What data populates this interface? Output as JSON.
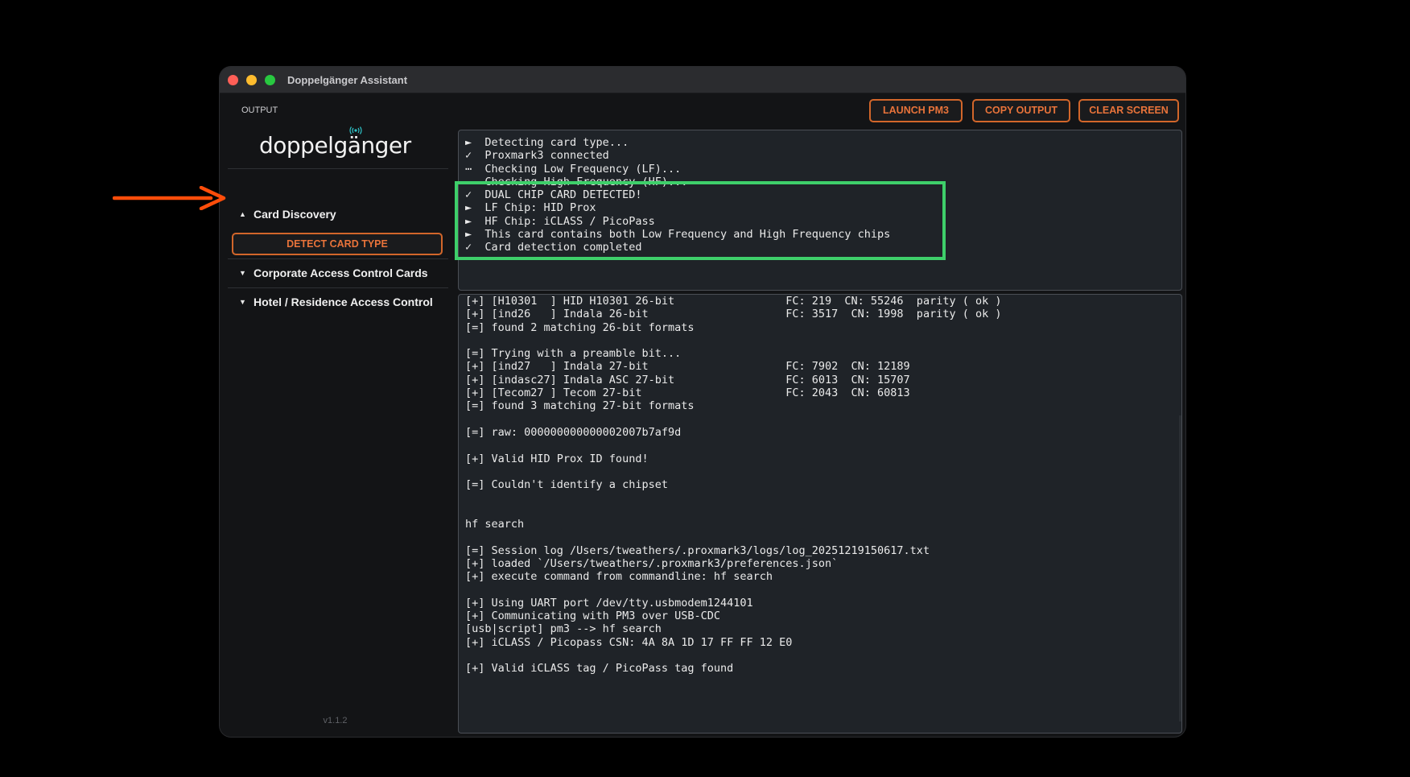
{
  "window": {
    "title": "Doppelgänger Assistant"
  },
  "sidebar": {
    "logo": "doppelgänger",
    "sections": [
      {
        "label": "Card Discovery",
        "caret": "▲"
      },
      {
        "label": "Corporate Access Control Cards",
        "caret": "▼"
      },
      {
        "label": "Hotel / Residence Access Control",
        "caret": "▼"
      }
    ],
    "detect_button": "DETECT CARD TYPE",
    "version": "v1.1.2"
  },
  "output": {
    "label": "OUTPUT",
    "buttons": {
      "launch": "LAUNCH PM3",
      "copy": "COPY OUTPUT",
      "clear": "CLEAR SCREEN"
    },
    "status_lines": [
      "►  Detecting card type...",
      "✓  Proxmark3 connected",
      "⋯  Checking Low Frequency (LF)...",
      "   Checking High Frequency (HF)...",
      "✓  DUAL CHIP CARD DETECTED!",
      "►  LF Chip: HID Prox",
      "►  HF Chip: iCLASS / PicoPass",
      "►  This card contains both Low Frequency and High Frequency chips",
      "✓  Card detection completed"
    ],
    "log_lines": [
      "[+] [H10301  ] HID H10301 26-bit                 FC: 219  CN: 55246  parity ( ok )",
      "[+] [ind26   ] Indala 26-bit                     FC: 3517  CN: 1998  parity ( ok )",
      "[=] found 2 matching 26-bit formats",
      "",
      "[=] Trying with a preamble bit...",
      "[+] [ind27   ] Indala 27-bit                     FC: 7902  CN: 12189",
      "[+] [indasc27] Indala ASC 27-bit                 FC: 6013  CN: 15707",
      "[+] [Tecom27 ] Tecom 27-bit                      FC: 2043  CN: 60813",
      "[=] found 3 matching 27-bit formats",
      "",
      "[=] raw: 000000000000002007b7af9d",
      "",
      "[+] Valid HID Prox ID found!",
      "",
      "[=] Couldn't identify a chipset",
      "",
      "",
      "hf search",
      "",
      "[=] Session log /Users/tweathers/.proxmark3/logs/log_20251219150617.txt",
      "[+] loaded `/Users/tweathers/.proxmark3/preferences.json`",
      "[+] execute command from commandline: hf search",
      "",
      "[+] Using UART port /dev/tty.usbmodem1244101",
      "[+] Communicating with PM3 over USB-CDC",
      "[usb|script] pm3 --> hf search",
      "[+] iCLASS / Picopass CSN: 4A 8A 1D 17 FF FF 12 E0",
      "",
      "[+] Valid iCLASS tag / PicoPass tag found"
    ]
  },
  "colors": {
    "accent": "#e8733a",
    "highlight": "#3ecf6a",
    "arrow": "#ff4d0a"
  }
}
